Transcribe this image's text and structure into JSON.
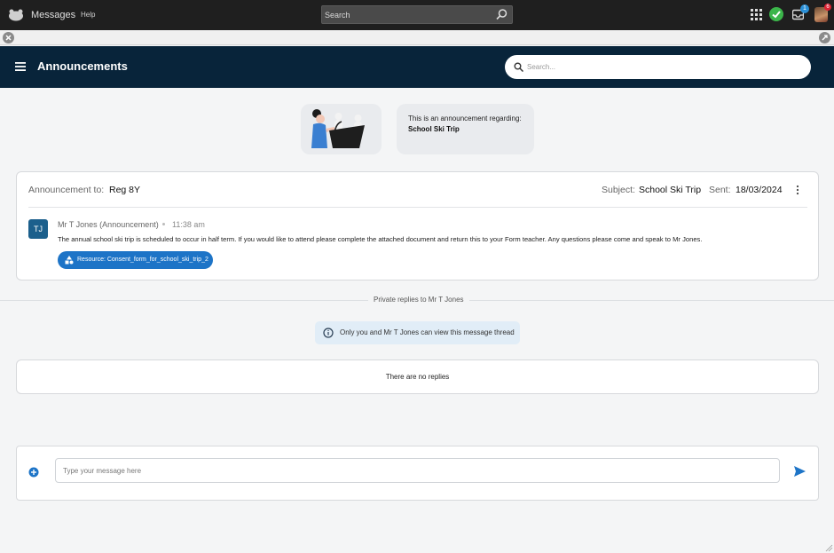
{
  "topbar": {
    "app_name": "Messages",
    "help_label": "Help",
    "search_placeholder": "Search",
    "inbox_badge": "1",
    "avatar_badge": "6"
  },
  "header": {
    "title": "Announcements",
    "search_placeholder": "Search..."
  },
  "regarding": {
    "line1": "This is an announcement regarding:",
    "topic": "School Ski Trip"
  },
  "announcement": {
    "to_label": "Announcement to:",
    "to_value": "Reg 8Y",
    "subject_label": "Subject:",
    "subject_value": "School Ski Trip",
    "sent_label": "Sent:",
    "sent_value": "18/03/2024",
    "avatar_initials": "TJ",
    "sender": "Mr T Jones (Announcement)",
    "time": "11:38 am",
    "body": "The annual school ski trip is scheduled to occur in half term. If you would like to attend please complete the attached document and return this to your Form teacher. Any questions please come and speak to Mr Jones.",
    "resource_label": "Resource: Consent_form_for_school_ski_trip_2"
  },
  "replies": {
    "section_label": "Private replies to Mr T Jones",
    "privacy_note": "Only you and Mr T Jones can view this message thread",
    "empty_text": "There are no replies"
  },
  "composer": {
    "placeholder": "Type your message here"
  },
  "colors": {
    "header_bg": "#08243a",
    "accent": "#1d74c7",
    "status_green": "#3bb54a"
  }
}
